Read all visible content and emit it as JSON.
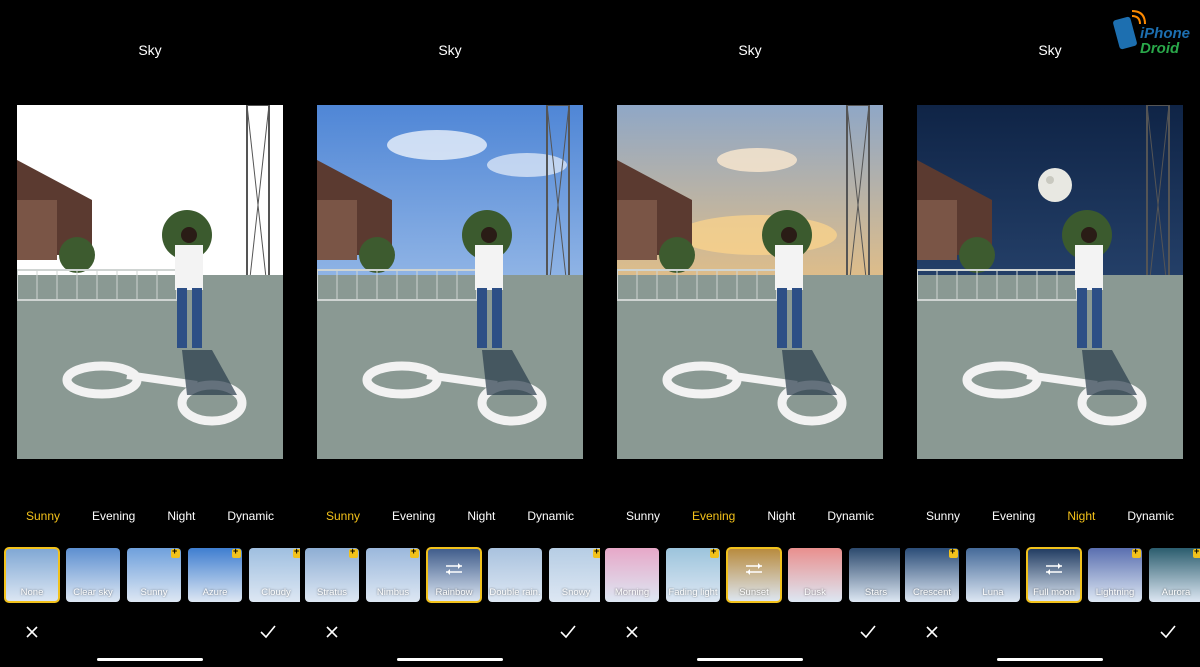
{
  "screen_title": "Sky",
  "tabs": [
    "Sunny",
    "Evening",
    "Night",
    "Dynamic"
  ],
  "panels": [
    {
      "active_tab": 0,
      "thumbs": [
        {
          "label": "None",
          "selected": true,
          "bg": "#7fa7d4",
          "badge": false
        },
        {
          "label": "Clear sky",
          "bg": "#5d8fd0",
          "badge": false
        },
        {
          "label": "Sunny",
          "bg": "#6fa0dc",
          "badge": true
        },
        {
          "label": "Azure",
          "bg": "#3f7ed0",
          "badge": true
        },
        {
          "label": "Cloudy",
          "bg": "#9fbfe0",
          "badge": true
        }
      ]
    },
    {
      "active_tab": 0,
      "thumbs": [
        {
          "label": "Stratus",
          "bg": "#8eaed4",
          "badge": true
        },
        {
          "label": "Nimbus",
          "bg": "#9bb8dc",
          "badge": true
        },
        {
          "label": "Rainbow",
          "selected": true,
          "bg": "#3e5b8a",
          "badge": false,
          "adjust": true
        },
        {
          "label": "Double rain.",
          "bg": "#a9c2de",
          "badge": false
        },
        {
          "label": "Snowy",
          "bg": "#b6cde4",
          "badge": true
        }
      ]
    },
    {
      "active_tab": 1,
      "thumbs": [
        {
          "label": "Morning",
          "bg": "#e7a8c8",
          "badge": false
        },
        {
          "label": "Fading light",
          "bg": "#9cc4dc",
          "badge": true
        },
        {
          "label": "Sunset",
          "selected": true,
          "bg": "#b88a3c",
          "badge": false,
          "adjust": true
        },
        {
          "label": "Dusk",
          "bg": "#e98f8e",
          "badge": false
        },
        {
          "label": "Stars",
          "bg": "#2c4a6e",
          "badge": false
        }
      ]
    },
    {
      "active_tab": 2,
      "thumbs": [
        {
          "label": "Crescent",
          "bg": "#2b4d78",
          "badge": true
        },
        {
          "label": "Luna",
          "bg": "#456a99",
          "badge": false
        },
        {
          "label": "Full moon",
          "selected": true,
          "bg": "#1f3a60",
          "badge": false,
          "adjust": true
        },
        {
          "label": "Lightning",
          "bg": "#5a6fb0",
          "badge": true
        },
        {
          "label": "Aurora",
          "bg": "#2b5d6e",
          "badge": true
        }
      ]
    }
  ],
  "sky_colors": [
    "#ffffff",
    "#6e9fe0",
    "#e9a25a",
    "#1b3560"
  ],
  "logo": {
    "line1": "iPhone",
    "line2": "Droid"
  },
  "icons": {
    "cancel": "close-icon",
    "confirm": "check-icon",
    "adjust": "sliders-icon"
  }
}
